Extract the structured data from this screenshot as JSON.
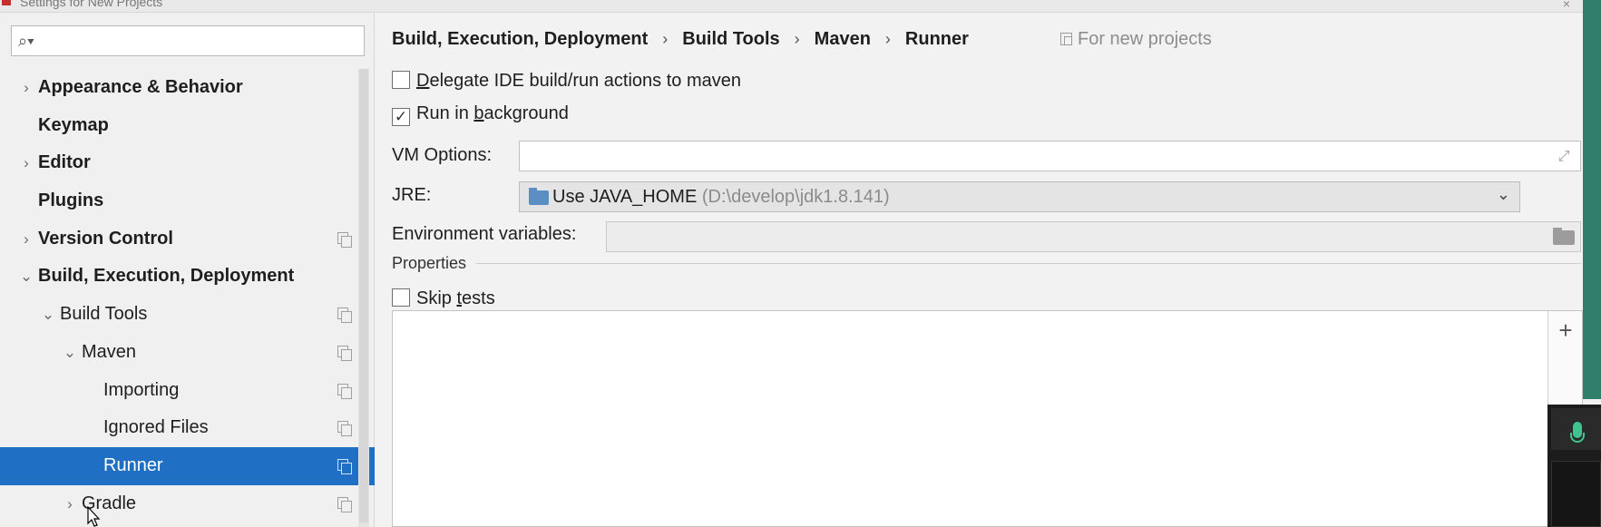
{
  "window": {
    "title": "Settings for New Projects",
    "close_glyph": "×"
  },
  "search": {
    "icon": "search-icon",
    "value": ""
  },
  "tree": [
    {
      "label": "Appearance & Behavior",
      "indent": 0,
      "chevron": "›",
      "bold": true,
      "copy": false,
      "selected": false
    },
    {
      "label": "Keymap",
      "indent": 0,
      "chevron": "",
      "bold": true,
      "copy": false,
      "selected": false
    },
    {
      "label": "Editor",
      "indent": 0,
      "chevron": "›",
      "bold": true,
      "copy": false,
      "selected": false
    },
    {
      "label": "Plugins",
      "indent": 0,
      "chevron": "",
      "bold": true,
      "copy": false,
      "selected": false
    },
    {
      "label": "Version Control",
      "indent": 0,
      "chevron": "›",
      "bold": true,
      "copy": true,
      "selected": false
    },
    {
      "label": "Build, Execution, Deployment",
      "indent": 0,
      "chevron": "⌄",
      "bold": true,
      "copy": false,
      "selected": false
    },
    {
      "label": "Build Tools",
      "indent": 1,
      "chevron": "⌄",
      "bold": false,
      "copy": true,
      "selected": false
    },
    {
      "label": "Maven",
      "indent": 2,
      "chevron": "⌄",
      "bold": false,
      "copy": true,
      "selected": false
    },
    {
      "label": "Importing",
      "indent": 3,
      "chevron": "",
      "bold": false,
      "copy": true,
      "selected": false
    },
    {
      "label": "Ignored Files",
      "indent": 3,
      "chevron": "",
      "bold": false,
      "copy": true,
      "selected": false
    },
    {
      "label": "Runner",
      "indent": 3,
      "chevron": "",
      "bold": false,
      "copy": true,
      "selected": true
    },
    {
      "label": "Gradle",
      "indent": 2,
      "chevron": "›",
      "bold": false,
      "copy": true,
      "selected": false
    }
  ],
  "breadcrumb": {
    "items": [
      "Build, Execution, Deployment",
      "Build Tools",
      "Maven",
      "Runner"
    ],
    "separator": "›",
    "scope_label": "For new projects"
  },
  "options": {
    "delegate": {
      "label_u": "D",
      "label_rest": "elegate IDE build/run actions to maven",
      "checked": false
    },
    "background": {
      "label_pre": "Run in ",
      "label_u": "b",
      "label_rest": "ackground",
      "checked": true
    },
    "vm_label": "VM Options:",
    "vm_value": "",
    "jre_label": "JRE:",
    "jre_value": "Use JAVA_HOME",
    "jre_path": "(D:\\develop\\jdk1.8.141)",
    "env_label": "Environment variables:",
    "env_value": ""
  },
  "properties": {
    "section_title": "Properties",
    "skip_tests": {
      "label_pre": "Skip ",
      "label_u": "t",
      "label_rest": "ests",
      "checked": false
    },
    "add_label": "+"
  },
  "colors": {
    "selection": "#1f6fc4",
    "mic_accent": "#3ec48e",
    "side_strip": "#2f7f6a"
  }
}
